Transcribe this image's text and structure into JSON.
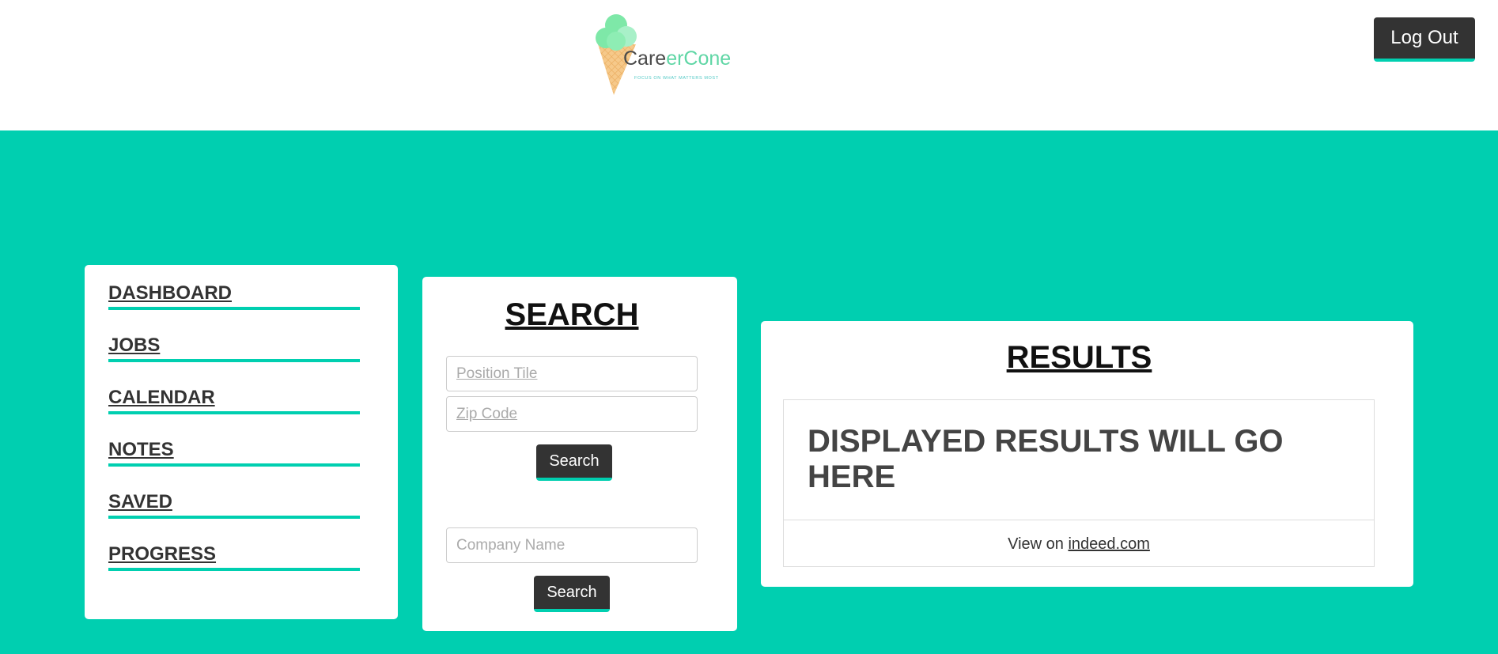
{
  "header": {
    "logo": {
      "brand_prefix": "Care",
      "brand_mid": "er",
      "brand_suffix": "Cone",
      "tagline": "FOCUS ON WHAT MATTERS MOST"
    },
    "logout_label": "Log Out"
  },
  "colors": {
    "accent": "#00cfb0",
    "dark_button": "#333333",
    "panel": "#ffffff"
  },
  "nav": {
    "items": [
      {
        "label": "DASHBOARD"
      },
      {
        "label": "JOBS"
      },
      {
        "label": "CALENDAR"
      },
      {
        "label": "NOTES"
      },
      {
        "label": "SAVED"
      },
      {
        "label": "PROGRESS"
      }
    ]
  },
  "search": {
    "title": "SEARCH",
    "position_placeholder": "Position Tile",
    "zip_placeholder": "Zip Code",
    "search_label": "Search",
    "company_placeholder": "Company Name",
    "company_search_label": "Search"
  },
  "results": {
    "title": "RESULTS",
    "card_text": "DISPLAYED RESULTS WILL GO HERE",
    "footer_prefix": "View on ",
    "footer_link": "indeed.com"
  }
}
